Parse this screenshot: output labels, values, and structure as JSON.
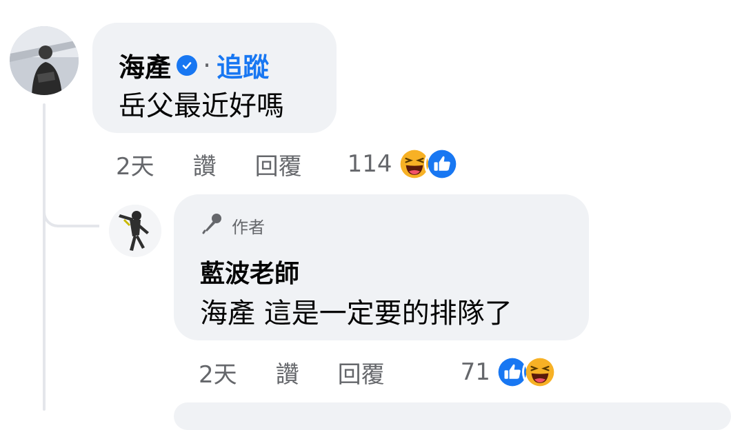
{
  "comment": {
    "author": "海產",
    "separator": "·",
    "follow_label": "追蹤",
    "text": "岳父最近好嗎",
    "time": "2天",
    "like_label": "讚",
    "reply_label": "回覆",
    "reaction_count": "114",
    "reactions": [
      "haha-icon",
      "like-icon"
    ]
  },
  "reply": {
    "badge_label": "作者",
    "author": "藍波老師",
    "text": "海產 這是一定要的排隊了",
    "time": "2天",
    "like_label": "讚",
    "reply_label": "回覆",
    "reaction_count": "71",
    "reactions": [
      "like-icon",
      "haha-icon"
    ]
  },
  "colors": {
    "accent": "#1877f2",
    "bubble": "#f0f2f5",
    "secondary_text": "#65676b",
    "haha": "#f7b125"
  }
}
